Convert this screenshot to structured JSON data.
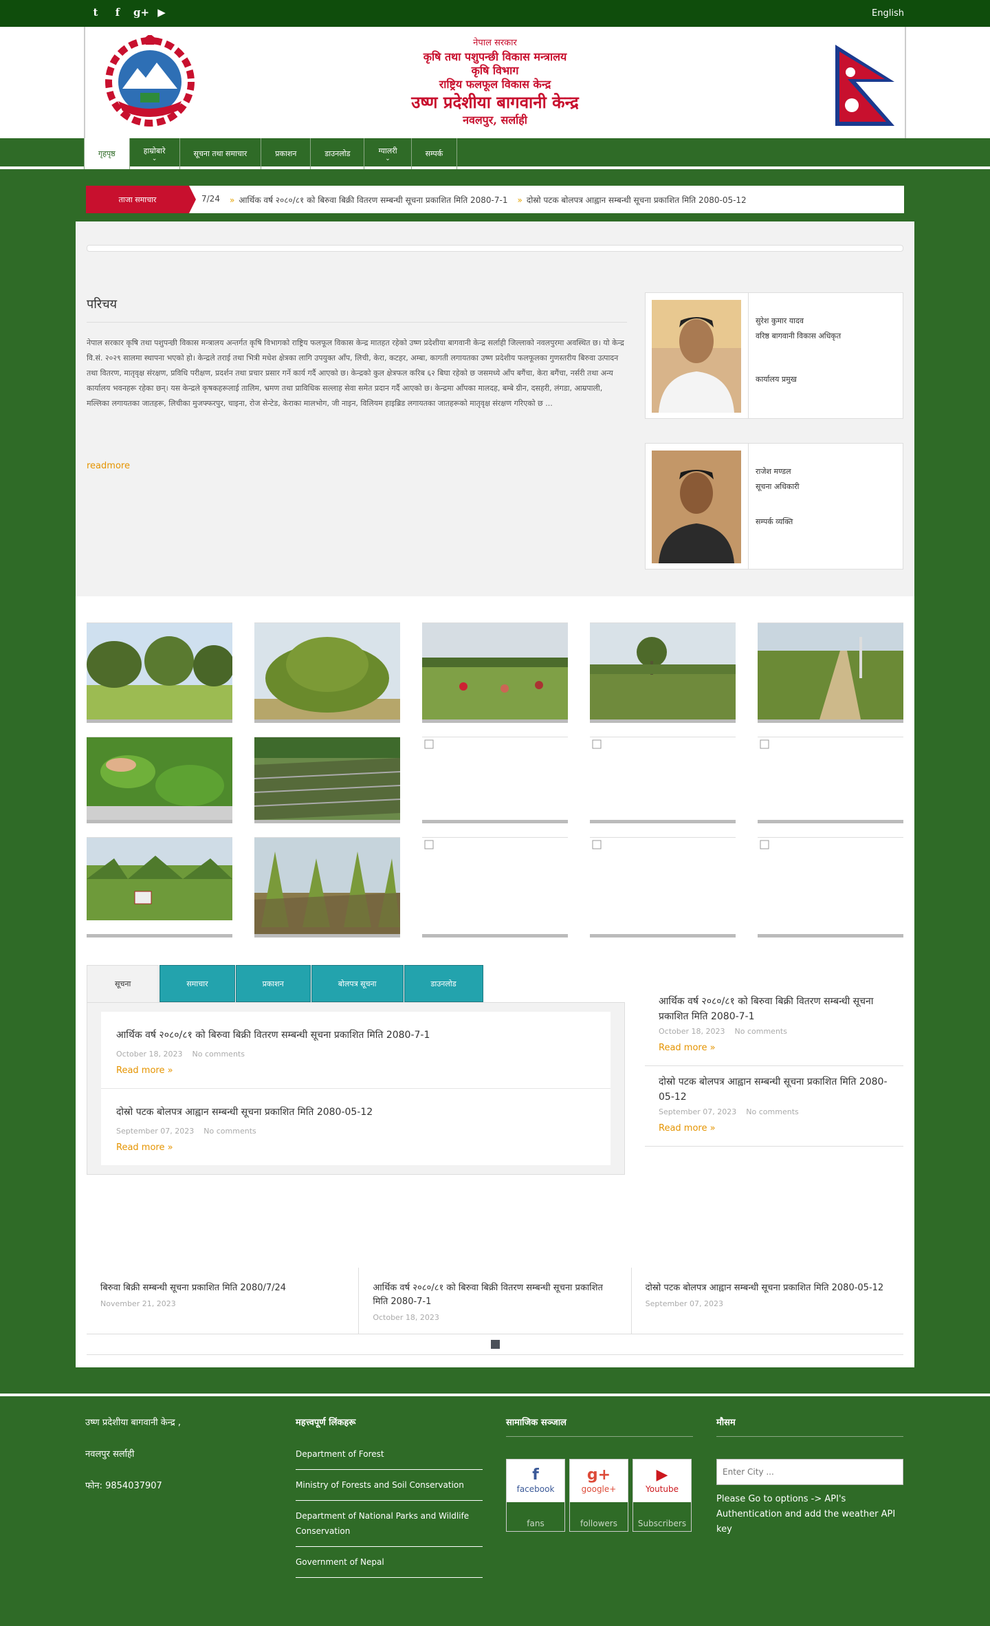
{
  "topbar": {
    "social": [
      {
        "icon": "twitter-icon",
        "glyph": "t"
      },
      {
        "icon": "facebook-icon",
        "glyph": "f"
      },
      {
        "icon": "google-plus-icon",
        "glyph": "g+"
      },
      {
        "icon": "youtube-icon",
        "glyph": "▶"
      }
    ],
    "language": "English"
  },
  "header": {
    "line1": "नेपाल सरकार",
    "line2": "कृषि तथा पशुपन्छी विकास मन्त्रालय",
    "line3": "कृषि विभाग",
    "line4": "राष्ट्रिय फलफूल विकास केन्द्र",
    "line5": "उष्ण प्रदेशीया बागवानी केन्द्र",
    "line6": "नवलपुर, सर्लाही",
    "colors": {
      "title_red": "#c8102e",
      "nav_green": "#2f6b27",
      "topbar_green": "#0f4d0c"
    }
  },
  "nav": {
    "items": [
      {
        "label": "गृहपृष्ठ",
        "active": true,
        "dropdown": false
      },
      {
        "label": "हाम्रोबारे",
        "active": false,
        "dropdown": true
      },
      {
        "label": "सूचना तथा समाचार",
        "active": false,
        "dropdown": false
      },
      {
        "label": "प्रकाशन",
        "active": false,
        "dropdown": false
      },
      {
        "label": "डाउनलोड",
        "active": false,
        "dropdown": false
      },
      {
        "label": "ग्यालरी",
        "active": false,
        "dropdown": true
      },
      {
        "label": "सम्पर्क",
        "active": false,
        "dropdown": false
      }
    ]
  },
  "ticker": {
    "label": "ताजा समाचार",
    "items": [
      "7/24",
      "आर्थिक वर्ष २०८०/८१ को बिरुवा बिक्री वितरण सम्बन्धी सूचना प्रकाशित मिति 2080-7-1",
      "दोस्रो पटक बोलपत्र आह्वान सम्बन्धी सूचना प्रकाशित मिति 2080-05-12"
    ]
  },
  "intro": {
    "heading": "परिचय",
    "paragraph": "नेपाल सरकार कृषि तथा पशुपन्छी विकास मन्त्रालय अन्तर्गत कृषि विभागको राष्ट्रिय फलफूल विकास केन्द्र मातहत रहेको उष्ण प्रदेशीया बागवानी केन्द्र सर्लाही जिल्लाको नवलपुरमा अवस्थित छ। यो केन्द्र वि.सं. २०२९ सालमा स्थापना भएको हो। केन्द्रले तराई तथा भित्री मधेश क्षेत्रका लागि उपयुक्त आँप, लिची, केरा, कटहर, अम्बा, कागती लगायतका उष्ण प्रदेशीय फलफूलका गुणस्तरीय बिरुवा उत्पादन तथा वितरण, मातृवृक्ष संरक्षण, प्रविधि परीक्षण, प्रदर्शन तथा प्रचार प्रसार गर्ने कार्य गर्दै आएको छ। केन्द्रको कुल क्षेत्रफल करिब ६२ बिघा रहेको छ जसमध्ये आँप बगैंचा, केरा बगैंचा, नर्सरी तथा अन्य कार्यालय भवनहरू रहेका छन्। यस केन्द्रले कृषकहरूलाई तालिम, भ्रमण तथा प्राविधिक सल्लाह सेवा समेत प्रदान गर्दै आएको छ। केन्द्रमा आँपका मालदह, बम्बे ग्रीन, दसहरी, लंगडा, आम्रपाली, मल्लिका लगायतका जातहरू, लिचीका मुजफ्फरपुर, चाइना, रोज सेन्टेड, केराका मालभोग, जी नाइन, विलियम हाइब्रिड लगायतका जातहरूको मातृवृक्ष संरक्षण गरिएको छ ...",
    "readmore": "readmore"
  },
  "staff": [
    {
      "name": "सुरेश कुमार यादव",
      "post": "वरिष्ठ बागवानी विकास अधिकृत",
      "role": "कार्यालय प्रमुख"
    },
    {
      "name": "राजेश मण्डल",
      "post": "सूचना अधिकारी",
      "role": "सम्पर्क व्यक्ति"
    }
  ],
  "tabs": {
    "items": [
      "सूचना",
      "समाचार",
      "प्रकाशन",
      "बोलपत्र सूचना",
      "डाउनलोड"
    ],
    "posts": [
      {
        "title": "आर्थिक वर्ष २०८०/८१ को बिरुवा बिक्री वितरण सम्बन्धी सूचना प्रकाशित मिति 2080-7-1",
        "date": "October 18, 2023",
        "comments": "No comments",
        "more": "Read more »"
      },
      {
        "title": "दोस्रो पटक बोलपत्र आह्वान सम्बन्धी सूचना प्रकाशित मिति 2080-05-12",
        "date": "September 07, 2023",
        "comments": "No comments",
        "more": "Read more »"
      }
    ]
  },
  "side_posts": [
    {
      "title": "आर्थिक वर्ष २०८०/८१ को बिरुवा बिक्री वितरण सम्बन्धी सूचना प्रकाशित मिति 2080-7-1",
      "date": "October 18, 2023",
      "comments": "No comments",
      "more": "Read more »"
    },
    {
      "title": "दोस्रो पटक बोलपत्र आह्वान सम्बन्धी सूचना प्रकाशित मिति 2080-05-12",
      "date": "September 07, 2023",
      "comments": "No comments",
      "more": "Read more »"
    }
  ],
  "carousel": [
    {
      "title": "बिरुवा बिक्री सम्बन्धी सूचना प्रकाशित मिति 2080/7/24",
      "date": "November 21, 2023"
    },
    {
      "title": "आर्थिक वर्ष २०८०/८१ को बिरुवा बिक्री वितरण सम्बन्धी सूचना प्रकाशित मिति 2080-7-1",
      "date": "October 18, 2023"
    },
    {
      "title": "दोस्रो पटक बोलपत्र आह्वान सम्बन्धी सूचना प्रकाशित मिति 2080-05-12",
      "date": "September 07, 2023"
    }
  ],
  "footer": {
    "address": "उष्ण प्रदेशीया बागवानी केन्द्र ,",
    "location": "नवलपुर सर्लाही",
    "phone": "फोन: 9854037907",
    "links_heading": "महत्त्वपूर्ण लिंकहरू",
    "links": [
      "Department of Forest",
      "Ministry of Forests and Soil Conservation",
      "Department of National Parks and Wildlife Conservation",
      "Government of Nepal"
    ],
    "social_heading": "सामाजिक सञ्जाल",
    "social": [
      {
        "icon": "facebook-icon",
        "glyph": "f",
        "name": "facebook",
        "unit": "fans",
        "color": "#3b5998"
      },
      {
        "icon": "google-plus-icon",
        "glyph": "g+",
        "name": "google+",
        "unit": "followers",
        "color": "#dd4b39"
      },
      {
        "icon": "youtube-icon",
        "glyph": "▶",
        "name": "Youtube",
        "unit": "Subscribers",
        "color": "#cc181e"
      }
    ],
    "weather_heading": "मौसम",
    "city_placeholder": "Enter City ...",
    "weather_note": "Please Go to options -> API's Authentication and add the weather API key"
  }
}
